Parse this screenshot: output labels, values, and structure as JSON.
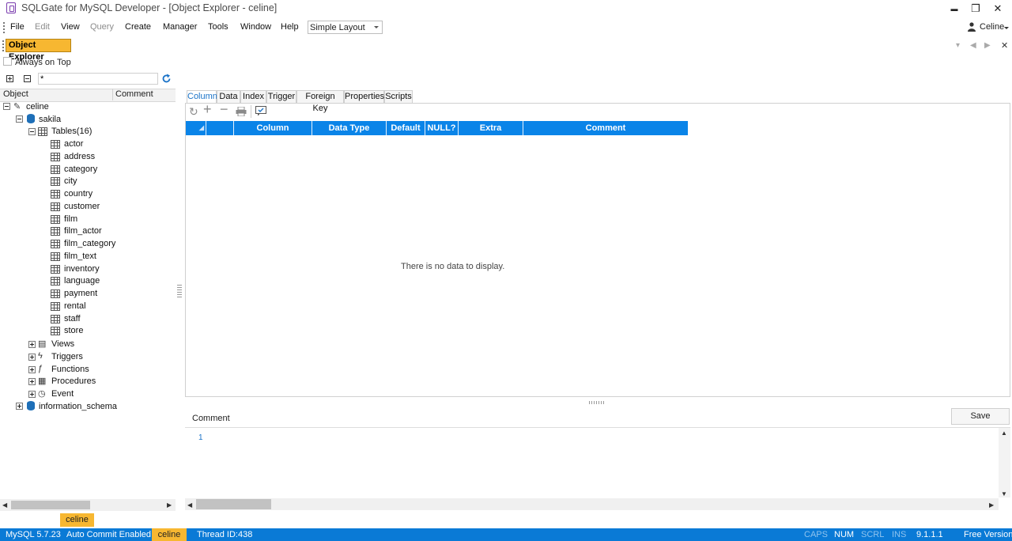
{
  "window": {
    "title": "SQLGate for MySQL Developer - [Object Explorer - celine]",
    "minimize_glyph": "▬",
    "restore_glyph": "❐",
    "close_glyph": "✕"
  },
  "menu": {
    "items": [
      "File",
      "Edit",
      "View",
      "Query",
      "Create",
      "Manager",
      "Tools",
      "Window",
      "Help"
    ],
    "disabled": [
      "Edit",
      "Query"
    ],
    "layout_select": "Simple Layout",
    "user": "Celine"
  },
  "object_explorer": {
    "tab_label": "Object Explorer",
    "always_on_top": "Always on Top",
    "always_on_top_checked": false,
    "filter_value": "*",
    "columns": [
      "Object",
      "Comment"
    ],
    "tree": {
      "connection": "celine",
      "database": "sakila",
      "tables_group": "Tables(16)",
      "tables": [
        "actor",
        "address",
        "category",
        "city",
        "country",
        "customer",
        "film",
        "film_actor",
        "film_category",
        "film_text",
        "inventory",
        "language",
        "payment",
        "rental",
        "staff",
        "store"
      ],
      "groups": [
        "Views",
        "Triggers",
        "Functions",
        "Procedures",
        "Event"
      ],
      "other_database": "information_schema"
    },
    "bottom_tab": "celine"
  },
  "detail": {
    "tabs": [
      "Column",
      "Data",
      "Index",
      "Trigger",
      "Foreign Key",
      "Properties",
      "Scripts"
    ],
    "active_tab": "Column",
    "grid_columns": [
      "",
      "",
      "Column",
      "Data Type",
      "Default",
      "NULL?",
      "Extra",
      "Comment"
    ],
    "empty_message": "There is no data to display.",
    "comment_label": "Comment",
    "save_label": "Save",
    "editor_line": "1"
  },
  "statusbar": {
    "version": "MySQL 5.7.23",
    "auto_commit": "Auto Commit Enabled",
    "connection": "celine",
    "thread": "Thread ID:438",
    "caps": "CAPS",
    "num": "NUM",
    "scrl": "SCRL",
    "ins": "INS",
    "app_version": "9.1.1.1",
    "license": "Free Version"
  },
  "colors": {
    "accent_orange": "#f7b731",
    "header_blue": "#0a84e8",
    "status_blue": "#0a7ad6"
  }
}
